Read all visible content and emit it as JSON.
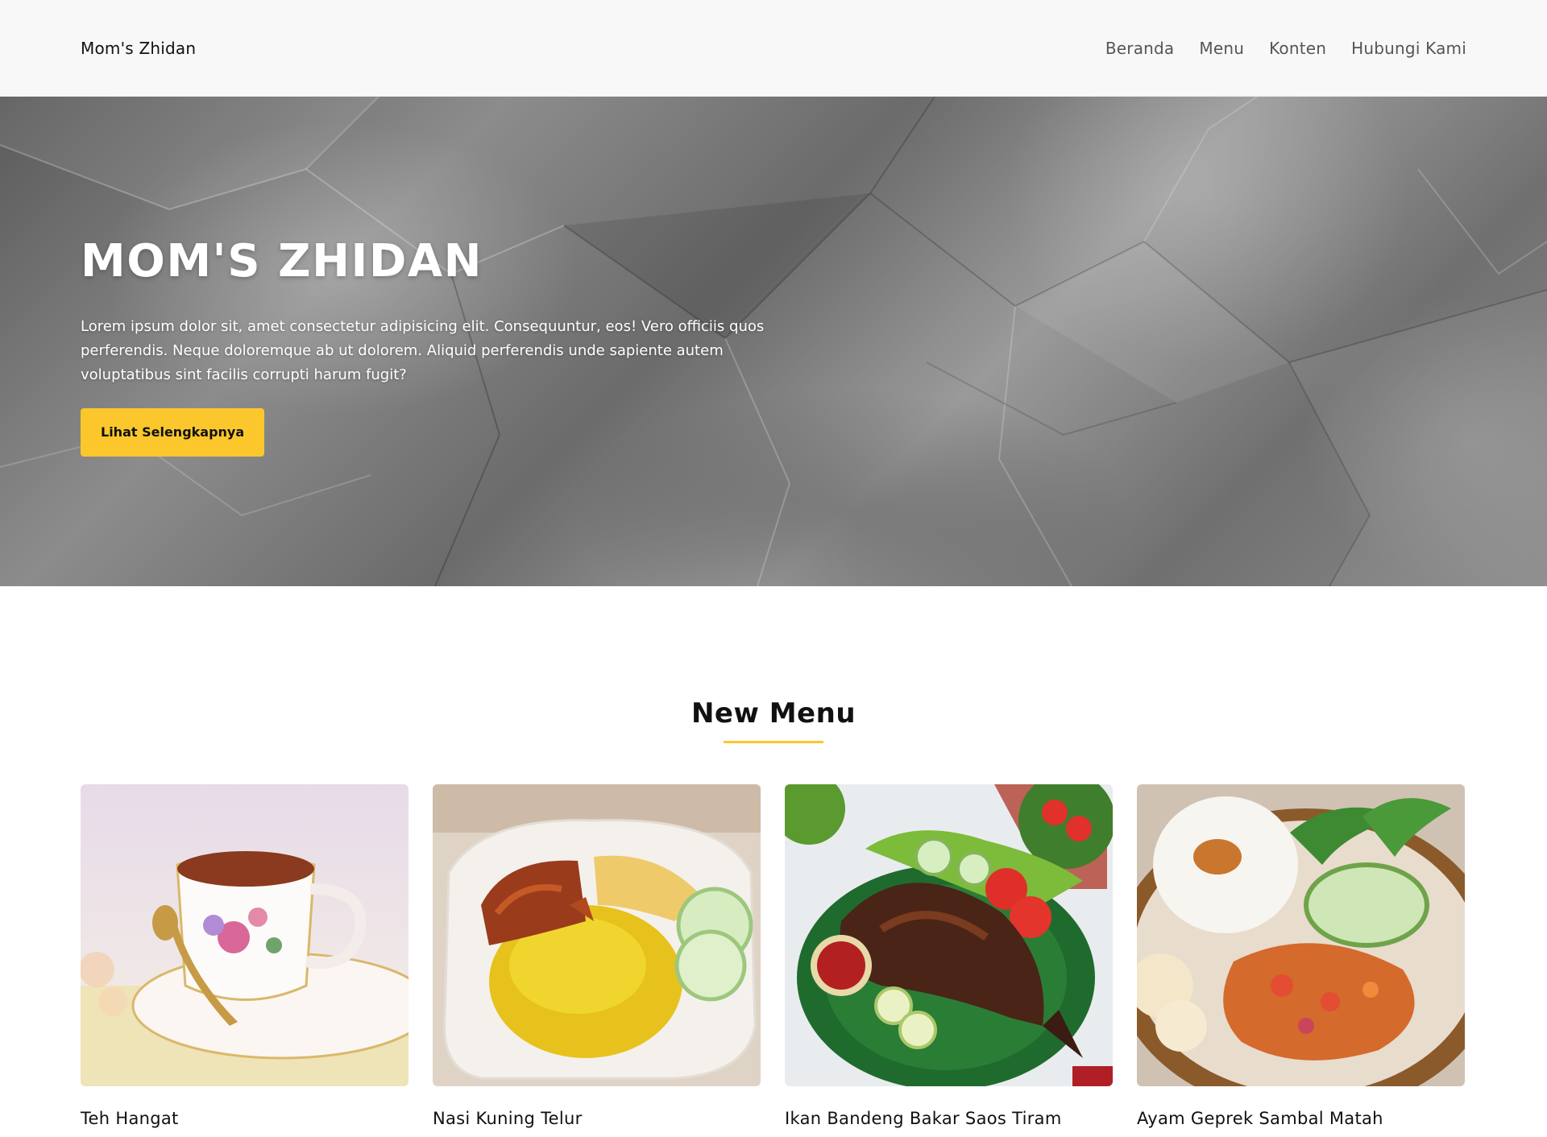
{
  "header": {
    "brand": "Mom's Zhidan",
    "nav": [
      "Beranda",
      "Menu",
      "Konten",
      "Hubungi Kami"
    ]
  },
  "hero": {
    "title": "MOM'S ZHIDAN",
    "text": "Lorem ipsum dolor sit, amet consectetur adipisicing elit. Consequuntur, eos! Vero officiis quos perferendis. Neque doloremque ab ut dolorem. Aliquid perferendis unde sapiente autem voluptatibus sint facilis corrupti harum fugit?",
    "button_label": "Lihat Selengkapnya"
  },
  "menu_section": {
    "title": "New Menu",
    "items": [
      {
        "name": "Teh Hangat"
      },
      {
        "name": "Nasi Kuning Telur"
      },
      {
        "name": "Ikan Bandeng Bakar Saos Tiram"
      },
      {
        "name": "Ayam Geprek Sambal Matah"
      }
    ]
  },
  "colors": {
    "accent": "#fcc72c",
    "header_bg": "#f8f8f8",
    "text": "#111111",
    "nav_text": "#555555"
  }
}
